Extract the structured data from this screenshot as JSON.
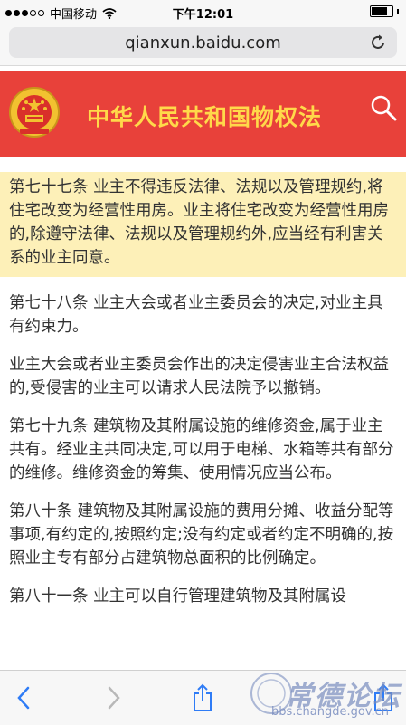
{
  "status_bar": {
    "carrier": "中国移动",
    "time": "下午12:01"
  },
  "browser": {
    "url": "qianxun.baidu.com"
  },
  "header": {
    "title": "中华人民共和国物权法",
    "colors": {
      "background": "#e8413a",
      "title": "#ffd94a"
    }
  },
  "articles": [
    {
      "text": "第七十七条 业主不得违反法律、法规以及管理规约,将住宅改变为经营性用房。业主将住宅改变为经营性用房的,除遵守法律、法规以及管理规约外,应当经有利害关系的业主同意。",
      "highlighted": true
    },
    {
      "text": "第七十八条 业主大会或者业主委员会的决定,对业主具有约束力。",
      "highlighted": false
    },
    {
      "text": "业主大会或者业主委员会作出的决定侵害业主合法权益的,受侵害的业主可以请求人民法院予以撤销。",
      "highlighted": false
    },
    {
      "text": "第七十九条 建筑物及其附属设施的维修资金,属于业主共有。经业主共同决定,可以用于电梯、水箱等共有部分的维修。维修资金的筹集、使用情况应当公布。",
      "highlighted": false
    },
    {
      "text": "第八十条 建筑物及其附属设施的费用分摊、收益分配等事项,有约定的,按照约定;没有约定或者约定不明确的,按照业主专有部分占建筑物总面积的比例确定。",
      "highlighted": false
    },
    {
      "text": "第八十一条 业主可以自行管理建筑物及其附属设",
      "highlighted": false
    }
  ],
  "watermark": {
    "title": "常德论坛",
    "url": "bbs.changde.gov.cn"
  }
}
